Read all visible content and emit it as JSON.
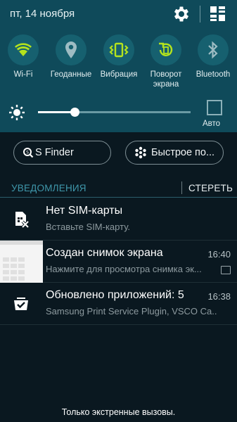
{
  "status": {
    "date": "пт, 14 ноября"
  },
  "toggles": [
    {
      "label": "Wi-Fi",
      "icon": "wifi-icon",
      "active": true
    },
    {
      "label": "Геоданные",
      "icon": "location-icon",
      "active": false
    },
    {
      "label": "Вибрация",
      "icon": "vibration-icon",
      "active": true
    },
    {
      "label": "Поворот экрана",
      "icon": "rotate-icon",
      "active": true
    },
    {
      "label": "Bluetooth",
      "icon": "bluetooth-icon",
      "active": false
    }
  ],
  "brightness": {
    "level": 0.24,
    "auto_label": "Авто",
    "auto_checked": false
  },
  "actions": {
    "s_finder": "S Finder",
    "quick_connect": "Быстрое по..."
  },
  "notifications_header": {
    "title": "УВЕДОМЛЕНИЯ",
    "clear": "СТЕРЕТЬ"
  },
  "notifications": [
    {
      "title": "Нет SIM-карты",
      "text": "Вставьте SIM-карту.",
      "time": ""
    },
    {
      "title": "Создан снимок экрана",
      "text": "Нажмите для просмотра снимка эк...",
      "time": "16:40"
    },
    {
      "title": "Обновлено приложений: 5",
      "text": "Samsung Print Service Plugin, VSCO Ca...",
      "time": "16:38"
    }
  ],
  "footer": {
    "emergency": "Только экстренные вызовы."
  },
  "colors": {
    "panel": "#0f4a5a",
    "active_icon": "#b4e31d",
    "inactive_icon": "#9dbcc3",
    "accent": "#3f97ab"
  }
}
